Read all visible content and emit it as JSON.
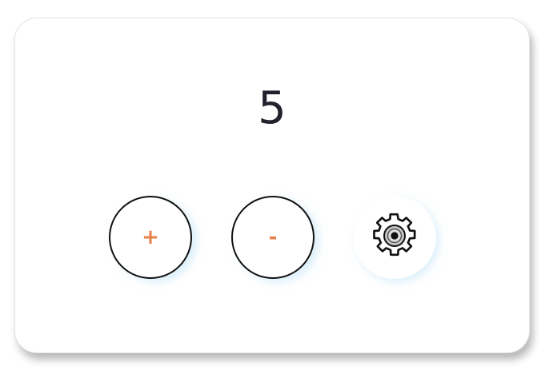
{
  "counter": {
    "value": "5"
  },
  "controls": {
    "increment_label": "+",
    "decrement_label": "-",
    "settings_icon": "gear-icon"
  },
  "colors": {
    "accent": "#e8804a",
    "text": "#22222e",
    "border": "#111111",
    "glow": "#bee1f5"
  }
}
